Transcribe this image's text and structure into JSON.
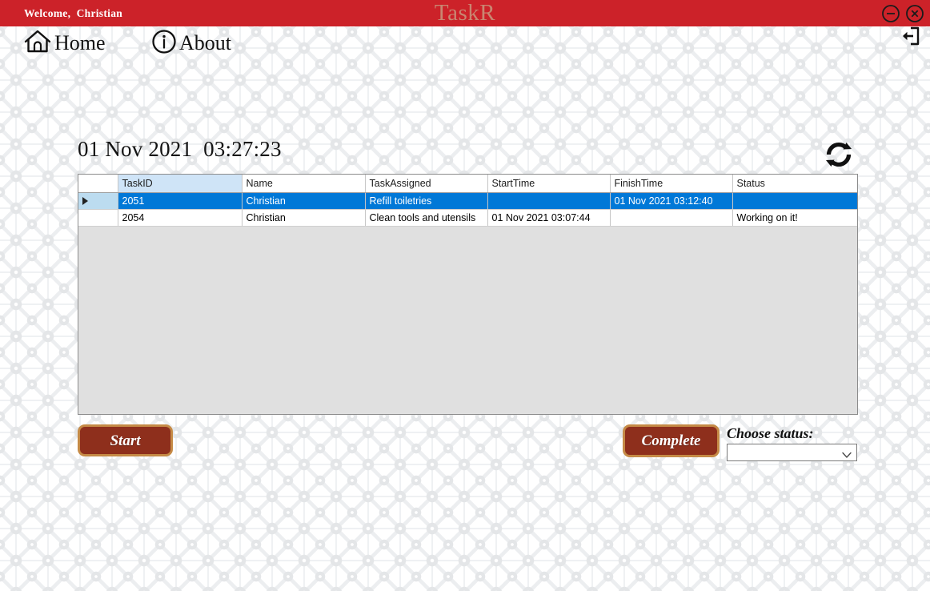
{
  "window": {
    "app_title": "TaskR",
    "welcome_text": "Welcome,  Christian",
    "minimize_label": "minimize",
    "close_label": "close",
    "accent_red": "#cc2229",
    "title_color": "#c98671"
  },
  "nav": {
    "items": [
      {
        "id": "home",
        "label": "Home",
        "icon": "home-icon"
      },
      {
        "id": "about",
        "label": "About",
        "icon": "info-icon"
      }
    ],
    "logout_icon": "logout-icon"
  },
  "main": {
    "datetime": "01 Nov 2021  03:27:23",
    "refresh_icon": "refresh-icon"
  },
  "grid": {
    "row_selector_glyph": "▶",
    "sorted_column": "TaskID",
    "columns": [
      {
        "key": "rowhdr",
        "label": ""
      },
      {
        "key": "taskid",
        "label": "TaskID"
      },
      {
        "key": "name",
        "label": "Name"
      },
      {
        "key": "task",
        "label": "TaskAssigned"
      },
      {
        "key": "start",
        "label": "StartTime"
      },
      {
        "key": "finish",
        "label": "FinishTime"
      },
      {
        "key": "status",
        "label": "Status"
      }
    ],
    "rows": [
      {
        "selected": true,
        "taskid": "2051",
        "name": "Christian",
        "task": "Refill toiletries",
        "start": "",
        "finish": "01 Nov 2021  03:12:40",
        "status": ""
      },
      {
        "selected": false,
        "taskid": "2054",
        "name": "Christian",
        "task": "Clean tools and utensils",
        "start": "01 Nov 2021  03:07:44",
        "finish": "",
        "status": "Working on it!"
      }
    ],
    "selection_color": "#0078d7",
    "sorted_header_color": "#cfe4f7",
    "empty_area_color": "#e0e0e0"
  },
  "actions": {
    "start_label": "Start",
    "complete_label": "Complete",
    "choose_status_label": "Choose status:",
    "status_value": "",
    "status_options": [
      ""
    ],
    "button_fill": "#8e2f1c",
    "button_border": "#c58a46"
  }
}
